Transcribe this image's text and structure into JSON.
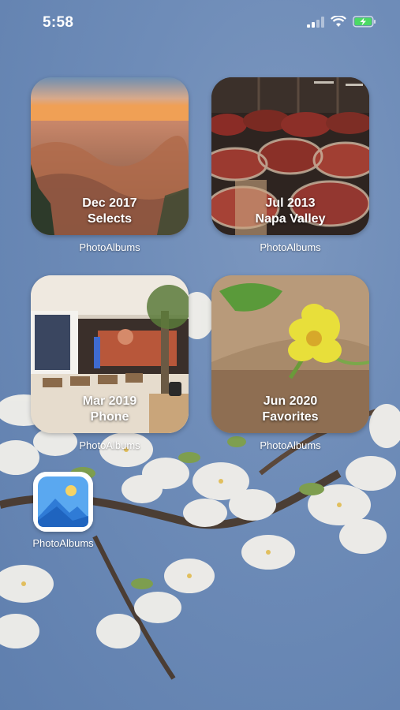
{
  "status_bar": {
    "time": "5:58"
  },
  "widgets": [
    {
      "line1": "Dec 2017",
      "line2": "Selects",
      "label": "PhotoAlbums"
    },
    {
      "line1": "Jul 2013",
      "line2": "Napa Valley",
      "label": "PhotoAlbums"
    },
    {
      "line1": "Mar 2019",
      "line2": "Phone",
      "label": "PhotoAlbums"
    },
    {
      "line1": "Jun 2020",
      "line2": "Favorites",
      "label": "PhotoAlbums"
    }
  ],
  "app": {
    "label": "PhotoAlbums",
    "icon": "photo-albums-icon"
  },
  "colors": {
    "wallpaper": "#6e8cb8",
    "battery": "#4cd964",
    "app_icon_sky": "#5aa8f0"
  }
}
